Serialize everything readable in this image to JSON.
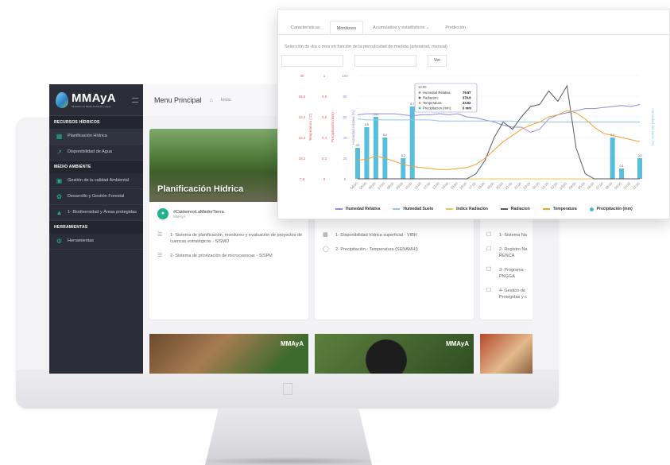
{
  "app": {
    "brand": "MMAyA",
    "brand_sub": "Ministerio de Medio Ambiente y Agua",
    "page_title": "Menu Principal",
    "breadcrumb": "Inicio"
  },
  "sidebar": {
    "sections": [
      {
        "label": "RECURSOS HÍDRICOS"
      },
      {
        "label": "MEDIO AMBIENTE"
      },
      {
        "label": "HERRAMIENTAS"
      }
    ],
    "items": [
      {
        "label": "Planificación Hídrica",
        "icon": "grid-icon"
      },
      {
        "label": "Disponibilidad de Agua",
        "icon": "chart-line-icon"
      },
      {
        "label": "Gestión de la calidad Ambiental",
        "icon": "lock-icon"
      },
      {
        "label": "Desarrollo y Gestión Forestal",
        "icon": "leaf-icon"
      },
      {
        "label": "1- Biodiversidad y Áreas protegidas",
        "icon": "mountain-icon"
      },
      {
        "label": "Herramientas",
        "icon": "gear-icon"
      }
    ]
  },
  "card1": {
    "caption": "Planificación Hídrica",
    "hashtag": "#CuidemosLaMadreTierra",
    "author": "MMAyA",
    "items": [
      "1- Sistema de planificación, monitoreo y evaluación de proyectos de cuencas estratégicos - SISMO",
      "2- Sistema de priorización de microcuencas - SISPM"
    ]
  },
  "card2": {
    "items": [
      "1- Disponibilidad hídrica superficial - VIBH",
      "2- Precipitación - Temperatura (SENAMHI)"
    ]
  },
  "card3": {
    "items": [
      "1- Sistema Na",
      "2- Registro Na RENCA",
      "3- Programa - PNGGA",
      "4- Gestion de Protegidas y c"
    ]
  },
  "photos": {
    "watermark": "MMAyA"
  },
  "panel": {
    "tabs": [
      "Características",
      "Monitoreo",
      "Acumulados y estadísticos ⌄",
      "Predicción"
    ],
    "hint": "Selección de día o mes en función de la periodicidad de medida (artesanal, manual)",
    "ver_button": "Ver"
  },
  "chart_data": {
    "type": "line",
    "axes": {
      "temperatura": {
        "label": "Temperatura (°C)",
        "ticks": [
          "30",
          "26.6",
          "23.4",
          "22.4",
          "19.2",
          "7.8"
        ],
        "color": "#e85d5d"
      },
      "precipitacion": {
        "label": "Precipitación (mm)",
        "ticks": [
          "1",
          "0.8",
          "0.6",
          "0.4",
          "0.2",
          "0"
        ],
        "color": "#e85d5d"
      },
      "humedad_relativa": {
        "label": "Humedad relativa (%)",
        "ticks": [
          "100",
          "80",
          "60",
          "40",
          "20",
          "0"
        ],
        "color": "#8c8cdf"
      },
      "humedad_suelo": {
        "label": "Humedad del suelo (%)",
        "color": "#8ec6e8"
      }
    },
    "x_ticks": [
      "04:00",
      "05:00",
      "06:00",
      "07:00",
      "08:00",
      "09:00",
      "10:00",
      "11:00",
      "12:00",
      "13:00",
      "14:00",
      "15:00",
      "16:00",
      "17:00",
      "18:00",
      "19:00",
      "20:00",
      "21:00",
      "22:00",
      "23:00",
      "00:00",
      "01:00",
      "02:00",
      "03:00",
      "04:00",
      "05:00",
      "06:00",
      "07:00",
      "08:00",
      "09:00",
      "10:00",
      "11:00"
    ],
    "tooltip": {
      "time": "13:00",
      "rows": [
        {
          "label": "Humedad Relativa:",
          "value": "79.57",
          "color": "#8c8cdf"
        },
        {
          "label": "Radiacion:",
          "value": "379.8",
          "color": "#555a66"
        },
        {
          "label": "Temperatura:",
          "value": "23.02",
          "color": "#f5a034"
        },
        {
          "label": "Precipitacion (mm):",
          "value": "0 mm",
          "color": "#45b8d8"
        }
      ]
    },
    "series": [
      {
        "name": "Humedad Relativa",
        "color": "#8c8cdf",
        "values": [
          62,
          63,
          63,
          63,
          63,
          62,
          61,
          62,
          62,
          63,
          62,
          63,
          60,
          59,
          57,
          55,
          52,
          50,
          50,
          45,
          48,
          58,
          62,
          64,
          66,
          68,
          68,
          69,
          70,
          71,
          70,
          72
        ]
      },
      {
        "name": "Humedad Suelo",
        "color": "#8ec6e8",
        "values": [
          58,
          57,
          57,
          57,
          57,
          57,
          57,
          57,
          57,
          56,
          56,
          56,
          56,
          56,
          56,
          56,
          56,
          56,
          55,
          55,
          55,
          55,
          55,
          55,
          55,
          55,
          55,
          55,
          55,
          55,
          55,
          55
        ]
      },
      {
        "name": "Indice Radiacion",
        "color": "#e8c468",
        "values": [
          0,
          0,
          0,
          0,
          0,
          0,
          0,
          0,
          0,
          0,
          0,
          0,
          0,
          0,
          0,
          0,
          0,
          0,
          0,
          0,
          0,
          0,
          0,
          0,
          0,
          0,
          0,
          0,
          0,
          0,
          0,
          0
        ]
      },
      {
        "name": "Radiacion",
        "color": "#555a66",
        "values": [
          0,
          0,
          0,
          0,
          0,
          0,
          0,
          0,
          0,
          0,
          0,
          0,
          0,
          5,
          18,
          40,
          55,
          48,
          60,
          70,
          72,
          85,
          75,
          90,
          30,
          5,
          0,
          0,
          0,
          0,
          0,
          0
        ]
      },
      {
        "name": "Temperatura",
        "color": "#f5a034",
        "values": [
          18,
          19,
          22,
          20,
          17,
          14,
          12,
          11,
          10,
          9,
          9,
          10,
          11,
          14,
          20,
          28,
          36,
          42,
          48,
          52,
          55,
          60,
          62,
          66,
          64,
          58,
          50,
          44,
          42,
          40,
          38,
          36
        ]
      },
      {
        "name": "Precipitación (mm)",
        "color": "#45b8d8",
        "values": [
          0.3,
          0.5,
          0.6,
          0.4,
          0,
          0.2,
          0.7,
          0,
          0,
          0,
          0,
          0,
          0,
          0,
          0,
          0,
          0,
          0,
          0,
          0,
          0,
          0,
          0,
          0,
          0,
          0,
          0,
          0,
          0.4,
          0.1,
          0,
          0.2
        ]
      }
    ]
  }
}
